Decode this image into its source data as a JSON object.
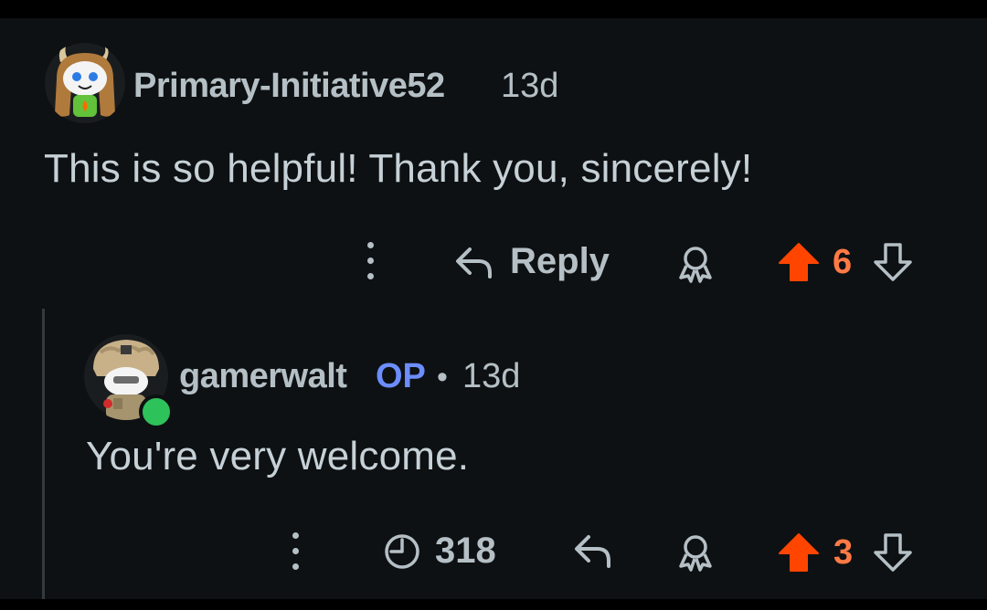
{
  "comments": [
    {
      "username": "Primary-Initiative52",
      "time": "13d",
      "body": "This is so helpful! Thank you, sincerely!",
      "reply_label": "Reply",
      "vote_count": "6"
    },
    {
      "username": "gamerwalt",
      "op_label": "OP",
      "separator": "•",
      "time": "13d",
      "body": "You're very welcome.",
      "views": "318",
      "vote_count": "3"
    }
  ],
  "icons": {
    "more": "more-vertical-icon",
    "reply": "reply-arrow-icon",
    "award": "award-icon",
    "upvote": "upvote-arrow-icon",
    "downvote": "downvote-arrow-icon",
    "views": "clock-views-icon"
  },
  "colors": {
    "background": "#0e1113",
    "text": "#c6d1d7",
    "muted": "#b5c0c6",
    "upvote": "#ff4500",
    "vote_count": "#ff7a45",
    "op": "#6c8dff",
    "online": "#2ec25a"
  }
}
